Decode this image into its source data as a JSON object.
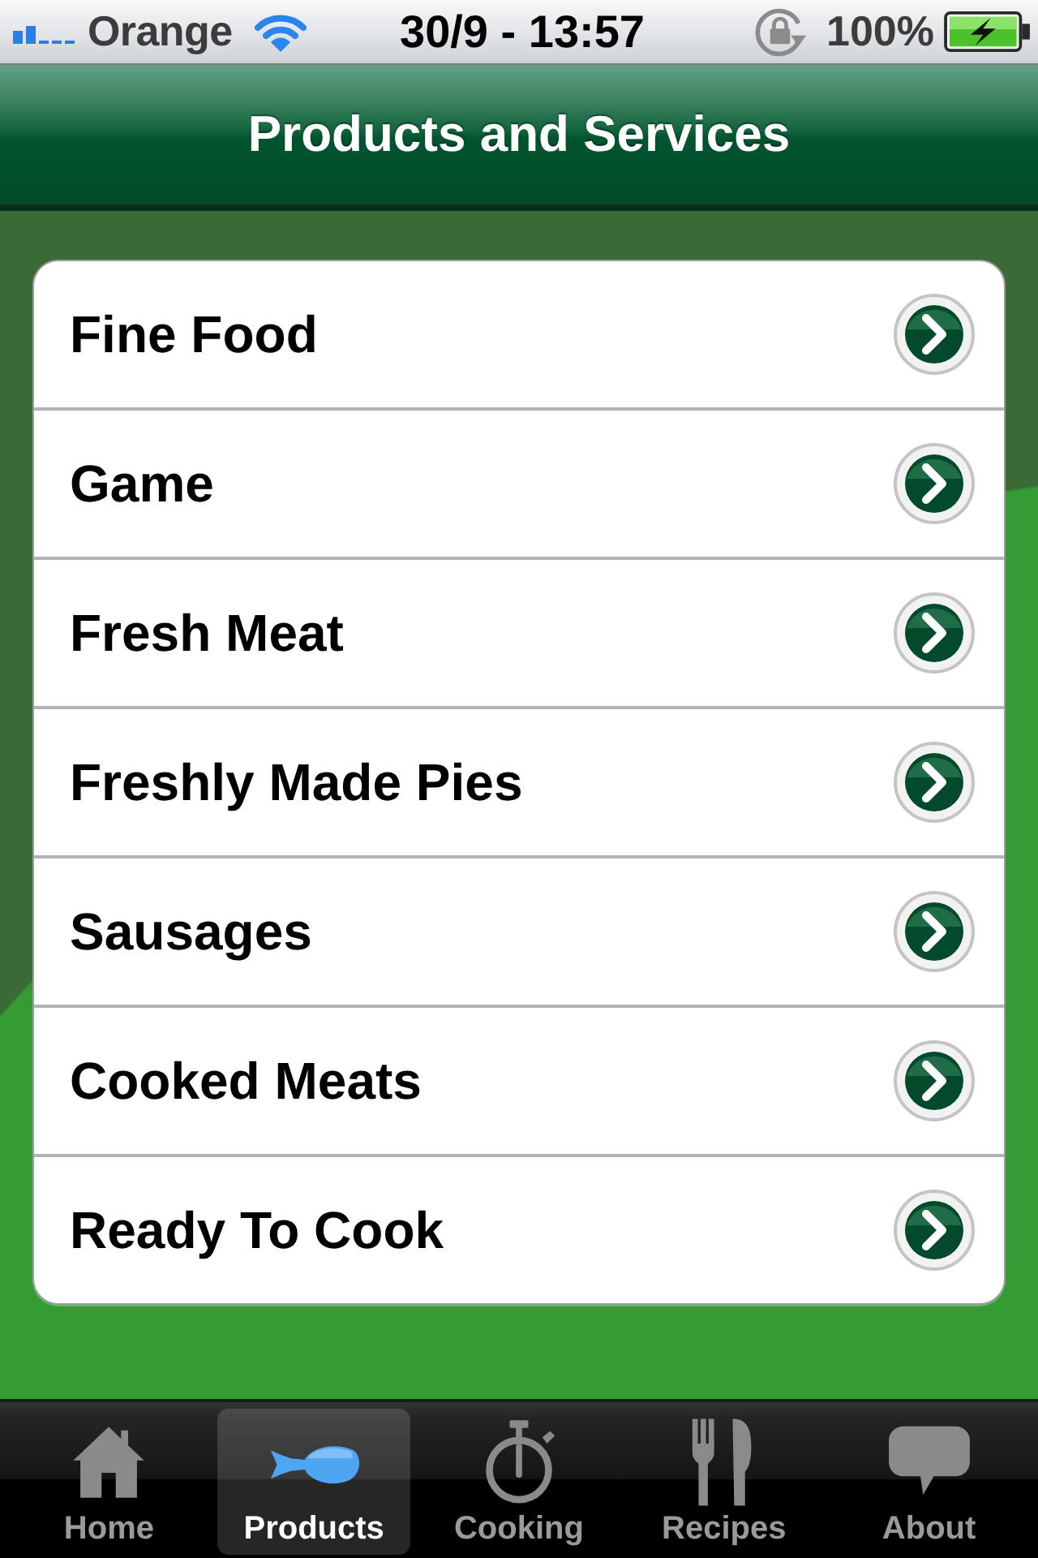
{
  "status_bar": {
    "carrier": "Orange",
    "time": "30/9 - 13:57",
    "battery": "100%"
  },
  "nav_bar": {
    "title": "Products and Services"
  },
  "list": {
    "items": [
      {
        "label": "Fine Food"
      },
      {
        "label": "Game"
      },
      {
        "label": "Fresh Meat"
      },
      {
        "label": "Freshly Made Pies"
      },
      {
        "label": "Sausages"
      },
      {
        "label": "Cooked Meats"
      },
      {
        "label": "Ready To Cook"
      }
    ]
  },
  "tab_bar": {
    "tabs": [
      {
        "label": "Home",
        "selected": false
      },
      {
        "label": "Products",
        "selected": true
      },
      {
        "label": "Cooking",
        "selected": false
      },
      {
        "label": "Recipes",
        "selected": false
      },
      {
        "label": "About",
        "selected": false
      }
    ]
  }
}
